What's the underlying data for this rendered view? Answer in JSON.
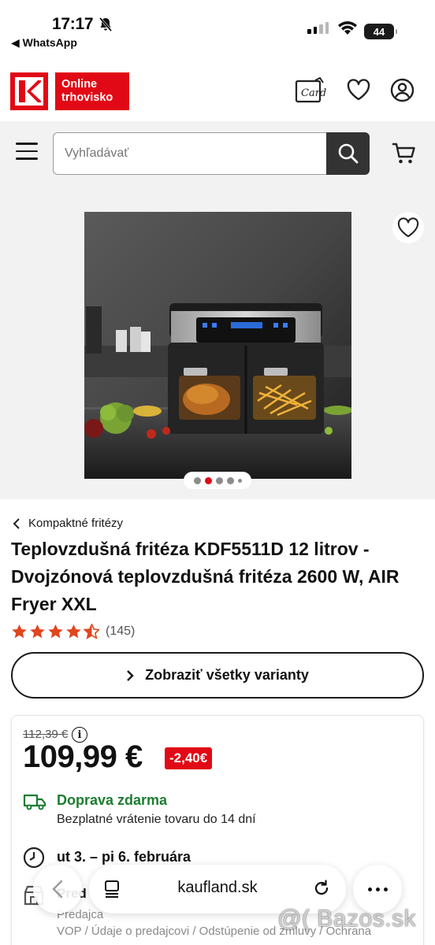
{
  "status_bar": {
    "time": "17:17",
    "back_app": "◀ WhatsApp",
    "battery": "44"
  },
  "header": {
    "logo_text_line1": "Online",
    "logo_text_line2": "trhovisko",
    "card_icon_label": "Card"
  },
  "search": {
    "placeholder": "Vyhľadávať"
  },
  "gallery": {
    "brand_colors": {
      "accent": "#e10915"
    }
  },
  "product": {
    "breadcrumb": "Kompaktné fritézy",
    "title": "Teplovzdušná fritéza KDF5511D 12 litrov - Dvojzónová teplovzdušná fritéza 2600 W, AIR Fryer XXL",
    "rating_value": 4.5,
    "rating_count": "(145)",
    "variants_button": "Zobraziť všetky varianty"
  },
  "price_card": {
    "old_price": "112,39 €",
    "price": "109,99 €",
    "discount": "-2,40€",
    "shipping_title": "Doprava zdarma",
    "shipping_sub": "Bezplatné vrátenie tovaru do 14 dní",
    "delivery": "ut 3. – pi 6. februára",
    "seller": "Pred",
    "seller_sub": "Predajca",
    "seller_links": "VOP / Údaje o predajcovi / Odstúpenie od zmluvy / Ochrana"
  },
  "browser": {
    "url": "kaufland.sk"
  },
  "watermark": "@( Bazos.sk"
}
